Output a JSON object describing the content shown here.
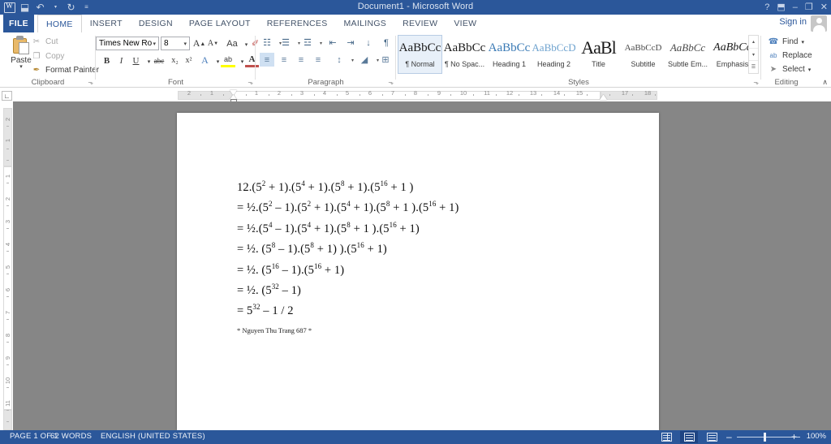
{
  "window": {
    "title": "Document1 - Microsoft Word",
    "quick_access": [
      {
        "name": "word-logo-icon",
        "glyph": "W"
      },
      {
        "name": "save-icon",
        "glyph": "⬓"
      },
      {
        "name": "undo-icon",
        "glyph": "↶"
      },
      {
        "name": "redo-icon",
        "glyph": "↻"
      },
      {
        "name": "customize-qat-icon",
        "glyph": "≡"
      }
    ],
    "controls": [
      {
        "name": "help-button",
        "glyph": "?"
      },
      {
        "name": "ribbon-display-options-button",
        "glyph": "⬒"
      },
      {
        "name": "minimize-button",
        "glyph": "–"
      },
      {
        "name": "restore-button",
        "glyph": "❐"
      },
      {
        "name": "close-button",
        "glyph": "✕"
      }
    ],
    "sign_in": "Sign in"
  },
  "tabs": {
    "file": "FILE",
    "items": [
      {
        "label": "HOME",
        "active": true
      },
      {
        "label": "INSERT",
        "active": false
      },
      {
        "label": "DESIGN",
        "active": false
      },
      {
        "label": "PAGE LAYOUT",
        "active": false
      },
      {
        "label": "REFERENCES",
        "active": false
      },
      {
        "label": "MAILINGS",
        "active": false
      },
      {
        "label": "REVIEW",
        "active": false
      },
      {
        "label": "VIEW",
        "active": false
      }
    ]
  },
  "ribbon": {
    "collapse_glyph": "∧",
    "groups": {
      "clipboard": {
        "label": "Clipboard",
        "paste": "Paste",
        "paste_caret": "▾",
        "commands": [
          {
            "label": "Cut",
            "icon": "scissors-icon",
            "glyph": "✂",
            "enabled": false
          },
          {
            "label": "Copy",
            "icon": "copy-icon",
            "glyph": "❐",
            "enabled": false
          },
          {
            "label": "Format Painter",
            "icon": "format-painter-icon",
            "glyph": "✒",
            "enabled": true
          }
        ],
        "launcher": "⬎"
      },
      "font": {
        "label": "Font",
        "font_name": "Times New Ro",
        "font_size": "8",
        "grow_font": "A",
        "shrink_font": "A",
        "change_case": "Aa",
        "clear_formatting": "✐",
        "bold": "B",
        "italic": "I",
        "underline": "U",
        "strikethrough": "abc",
        "subscript": "x₂",
        "superscript": "x²",
        "text_effects": "A",
        "highlight": "ab",
        "font_color": "A",
        "launcher": "⬎"
      },
      "paragraph": {
        "label": "Paragraph",
        "row1": [
          {
            "name": "bullets-button",
            "glyph": "☷"
          },
          {
            "name": "numbering-button",
            "glyph": "☰"
          },
          {
            "name": "multilevel-list-button",
            "glyph": "☲"
          },
          {
            "name": "decrease-indent-button",
            "glyph": "⇤"
          },
          {
            "name": "increase-indent-button",
            "glyph": "⇥"
          },
          {
            "name": "sort-button",
            "glyph": "↓"
          },
          {
            "name": "show-formatting-marks-button",
            "glyph": "¶"
          }
        ],
        "row2": [
          {
            "name": "align-left-button",
            "glyph": "≡"
          },
          {
            "name": "align-center-button",
            "glyph": "≡"
          },
          {
            "name": "align-right-button",
            "glyph": "≡"
          },
          {
            "name": "justify-button",
            "glyph": "≡"
          },
          {
            "name": "line-spacing-button",
            "glyph": "↕"
          },
          {
            "name": "shading-button",
            "glyph": "◢"
          },
          {
            "name": "borders-button",
            "glyph": "⊞"
          }
        ],
        "launcher": "⬎"
      },
      "styles": {
        "label": "Styles",
        "items": [
          {
            "preview": "AaBbCc",
            "name": "¶ Normal",
            "selected": true
          },
          {
            "preview": "AaBbCc",
            "name": "¶ No Spac...",
            "selected": false
          },
          {
            "preview": "AaBbCc",
            "name": "Heading 1",
            "selected": false
          },
          {
            "preview": "AaBbCcD",
            "name": "Heading 2",
            "selected": false
          },
          {
            "preview": "AaBl",
            "name": "Title",
            "selected": false
          },
          {
            "preview": "AaBbCcD",
            "name": "Subtitle",
            "selected": false
          },
          {
            "preview": "AaBbCc",
            "name": "Subtle Em...",
            "selected": false
          },
          {
            "preview": "AaBbCc",
            "name": "Emphasis",
            "selected": false
          }
        ],
        "scroll": [
          "▴",
          "▾",
          "☰"
        ],
        "launcher": "⬎"
      },
      "editing": {
        "label": "Editing",
        "commands": [
          {
            "label": "Find",
            "icon": "binoculars-icon",
            "glyph": "☎",
            "caret": "▾"
          },
          {
            "label": "Replace",
            "icon": "replace-icon",
            "glyph": "ab",
            "caret": ""
          },
          {
            "label": "Select",
            "icon": "select-icon",
            "glyph": "➤",
            "caret": "▾"
          }
        ]
      }
    }
  },
  "ruler": {
    "horizontal_labels": [
      "2",
      "1",
      "1",
      "2",
      "3",
      "4",
      "5",
      "6",
      "7",
      "8",
      "9",
      "10",
      "11",
      "12",
      "13",
      "14",
      "15",
      "17",
      "18"
    ],
    "vertical_labels": [
      "2",
      "1",
      "1",
      "2",
      "3",
      "4",
      "5",
      "6",
      "7",
      "8",
      "9",
      "10",
      "11"
    ]
  },
  "document": {
    "lines": [
      "12.(5<sup>2</sup> + 1).(5<sup>4</sup> + 1).(5<sup>8</sup> + 1).(5<sup>16</sup> + 1 )",
      "= ½.(5<sup>2</sup> – 1).(5<sup>2</sup> + 1).(5<sup>4</sup> + 1).(5<sup>8</sup> + 1 ).(5<sup>16</sup> + 1)",
      "= ½.(5<sup>4</sup> – 1).(5<sup>4</sup> + 1).(5<sup>8</sup> + 1 ).(5<sup>16</sup> + 1)",
      "= ½. (5<sup>8</sup> – 1).(5<sup>8</sup> + 1) ).(5<sup>16</sup> + 1)",
      "= ½. (5<sup>16</sup> – 1).(5<sup>16</sup> + 1)",
      "= ½. (5<sup>32</sup> – 1)",
      "= 5<sup>32</sup> – 1 / 2"
    ],
    "signature": "* Nguyen Thu Trang 687 *"
  },
  "status_bar": {
    "page": "PAGE 1 OF 1",
    "words": "62 WORDS",
    "language": "ENGLISH (UNITED STATES)",
    "views": [
      {
        "name": "read-mode-button",
        "active": false
      },
      {
        "name": "print-layout-button",
        "active": true
      },
      {
        "name": "web-layout-button",
        "active": false
      }
    ],
    "zoom_out": "–",
    "zoom_in": "+",
    "zoom_level": "100%"
  },
  "colors": {
    "brand_blue": "#2b579a",
    "status_blue": "#2b579a",
    "canvas_gray": "#868686",
    "ribbon_bg": "#ffffff"
  }
}
